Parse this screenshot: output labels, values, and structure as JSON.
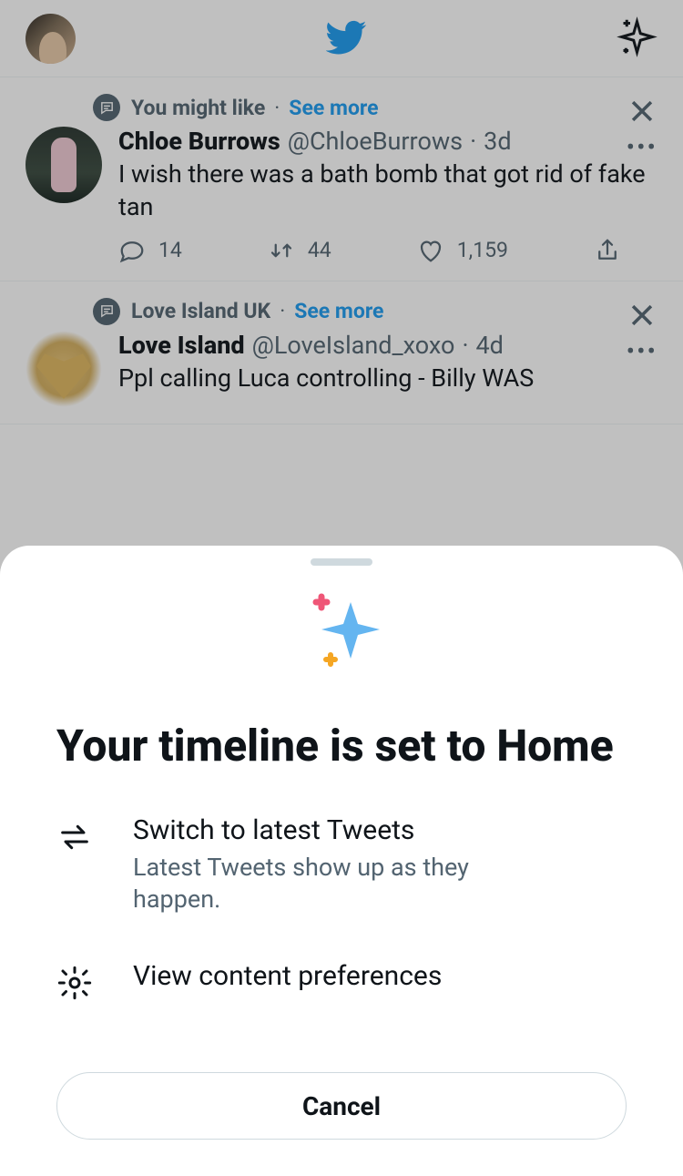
{
  "header": {
    "logo_name": "twitter-logo",
    "sparkle_name": "timeline-options"
  },
  "tweets": [
    {
      "topic": "You might like",
      "see_more": "See more",
      "name": "Chloe Burrows",
      "handle": "@ChloeBurrows",
      "time": "3d",
      "text": "I wish there was a bath bomb that got rid of fake tan",
      "replies": "14",
      "retweets": "44",
      "likes": "1,159"
    },
    {
      "topic": "Love Island UK",
      "see_more": "See more",
      "name": "Love Island",
      "handle": "@LoveIsland_xoxo",
      "time": "4d",
      "text": "Ppl calling Luca controlling - Billy WAS",
      "replies": "",
      "retweets": "",
      "likes": ""
    }
  ],
  "sheet": {
    "title": "Your timeline is set to Home",
    "option1_title": "Switch to latest Tweets",
    "option1_sub": "Latest Tweets show up as they happen.",
    "option2_title": "View content preferences",
    "cancel": "Cancel"
  }
}
